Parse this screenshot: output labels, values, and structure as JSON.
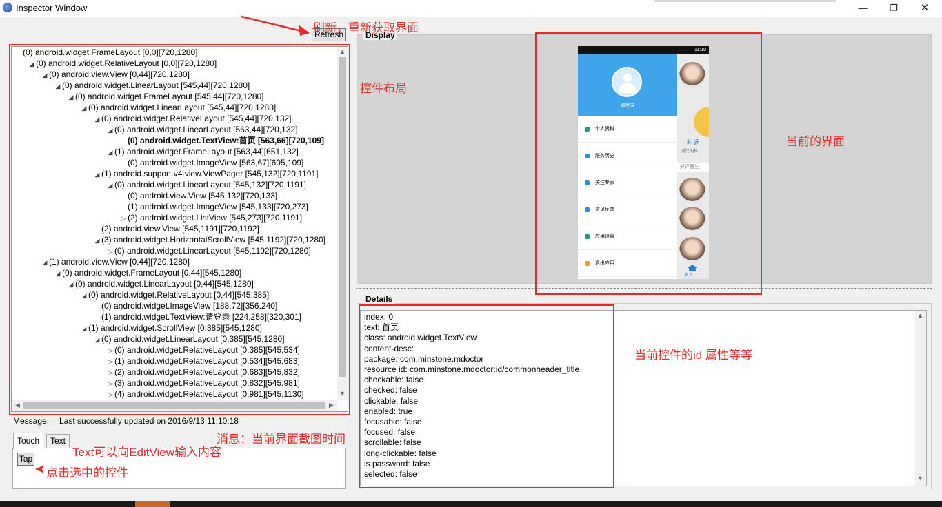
{
  "window": {
    "title": "Inspector Window",
    "minimize": "—",
    "maximize": "❐",
    "close": "✕"
  },
  "toolbar": {
    "refresh_label": "Refresh"
  },
  "tree": {
    "nodes": [
      {
        "indent": 0,
        "arrow": "",
        "text": "(0) android.widget.FrameLayout [0,0][720,1280]"
      },
      {
        "indent": 1,
        "arrow": "◢",
        "text": "(0) android.widget.RelativeLayout [0,0][720,1280]"
      },
      {
        "indent": 2,
        "arrow": "◢",
        "text": "(0) android.view.View [0,44][720,1280]"
      },
      {
        "indent": 3,
        "arrow": "◢",
        "text": "(0) android.widget.LinearLayout [545,44][720,1280]"
      },
      {
        "indent": 4,
        "arrow": "◢",
        "text": "(0) android.widget.FrameLayout [545,44][720,1280]"
      },
      {
        "indent": 5,
        "arrow": "◢",
        "text": "(0) android.widget.LinearLayout [545,44][720,1280]"
      },
      {
        "indent": 6,
        "arrow": "◢",
        "text": "(0) android.widget.RelativeLayout [545,44][720,132]"
      },
      {
        "indent": 7,
        "arrow": "◢",
        "text": "(0) android.widget.LinearLayout [563,44][720,132]"
      },
      {
        "indent": 8,
        "arrow": "",
        "text": "(0) android.widget.TextView:首页 [563,66][720,109]",
        "selected": true
      },
      {
        "indent": 7,
        "arrow": "◢",
        "text": "(1) android.widget.FrameLayout [563,44][651,132]"
      },
      {
        "indent": 8,
        "arrow": "",
        "text": "(0) android.widget.ImageView [563,67][605,109]"
      },
      {
        "indent": 6,
        "arrow": "◢",
        "text": "(1) android.support.v4.view.ViewPager [545,132][720,1191]"
      },
      {
        "indent": 7,
        "arrow": "◢",
        "text": "(0) android.widget.LinearLayout [545,132][720,1191]"
      },
      {
        "indent": 8,
        "arrow": "",
        "text": "(0) android.view.View [545,132][720,133]"
      },
      {
        "indent": 8,
        "arrow": "",
        "text": "(1) android.widget.ImageView [545,133][720,273]"
      },
      {
        "indent": 8,
        "arrow": "▷",
        "text": "(2) android.widget.ListView [545,273][720,1191]"
      },
      {
        "indent": 6,
        "arrow": "",
        "text": "(2) android.view.View [545,1191][720,1192]"
      },
      {
        "indent": 6,
        "arrow": "◢",
        "text": "(3) android.widget.HorizontalScrollView [545,1192][720,1280]"
      },
      {
        "indent": 7,
        "arrow": "▷",
        "text": "(0) android.widget.LinearLayout [545,1192][720,1280]"
      },
      {
        "indent": 2,
        "arrow": "◢",
        "text": "(1) android.view.View [0,44][720,1280]"
      },
      {
        "indent": 3,
        "arrow": "◢",
        "text": "(0) android.widget.FrameLayout [0,44][545,1280]"
      },
      {
        "indent": 4,
        "arrow": "◢",
        "text": "(0) android.widget.LinearLayout [0,44][545,1280]"
      },
      {
        "indent": 5,
        "arrow": "◢",
        "text": "(0) android.widget.RelativeLayout [0,44][545,385]"
      },
      {
        "indent": 6,
        "arrow": "",
        "text": "(0) android.widget.ImageView [188,72][356,240]"
      },
      {
        "indent": 6,
        "arrow": "",
        "text": "(1) android.widget.TextView:请登录 [224,258][320,301]"
      },
      {
        "indent": 5,
        "arrow": "◢",
        "text": "(1) android.widget.ScrollView [0,385][545,1280]"
      },
      {
        "indent": 6,
        "arrow": "◢",
        "text": "(0) android.widget.LinearLayout [0,385][545,1280]"
      },
      {
        "indent": 7,
        "arrow": "▷",
        "text": "(0) android.widget.RelativeLayout [0,385][545,534]"
      },
      {
        "indent": 7,
        "arrow": "▷",
        "text": "(1) android.widget.RelativeLayout [0,534][545,683]"
      },
      {
        "indent": 7,
        "arrow": "▷",
        "text": "(2) android.widget.RelativeLayout [0,683][545,832]"
      },
      {
        "indent": 7,
        "arrow": "▷",
        "text": "(3) android.widget.RelativeLayout [0,832][545,981]"
      },
      {
        "indent": 7,
        "arrow": "▷",
        "text": "(4) android.widget.RelativeLayout [0,981][545,1130]"
      }
    ]
  },
  "display": {
    "label": "Display",
    "phone": {
      "status_time": "11:10",
      "login_text": "请登录",
      "menu_items": [
        {
          "label": "个人资料",
          "color": "#21a06b"
        },
        {
          "label": "服务历史",
          "color": "#2e8ee0"
        },
        {
          "label": "关注专家",
          "color": "#2e8ee0"
        },
        {
          "label": "意见反馈",
          "color": "#2e8ee0"
        },
        {
          "label": "应用设置",
          "color": "#21a06b"
        },
        {
          "label": "退出应用",
          "color": "#f0a020"
        }
      ],
      "banner_text": "附近",
      "banner_sub": "对比的科",
      "doctors_header": "好评医生",
      "home_label": "首页"
    }
  },
  "details": {
    "label": "Details",
    "lines": [
      "index: 0",
      "text: 首页",
      "class: android.widget.TextView",
      "content-desc:",
      "package: com.minstone.mdoctor",
      "resource id: com.minstone.mdoctor:id/commonheader_title",
      "checkable: false",
      "checked: false",
      "clickable: false",
      "enabled: true",
      "focusable: false",
      "focused: false",
      "scrollable: false",
      "long-clickable: false",
      "is password: false",
      "selected: false"
    ]
  },
  "message": {
    "label": "Message:",
    "value": "Last successfully updated on 2016/9/13 11:10:18"
  },
  "tabs": {
    "touch": "Touch",
    "text": "Text",
    "tap_label": "Tap"
  },
  "annotations": {
    "refresh": "刷新，重新获取界面",
    "layout": "控件布局",
    "current_screen": "当前的界面",
    "attributes": "当前控件的id 属性等等",
    "message": "消息：当前界面截图时间",
    "text_tab": "Text可以向EditView输入内容",
    "tap": "点击选中的控件",
    "color": "#e62a2a"
  }
}
